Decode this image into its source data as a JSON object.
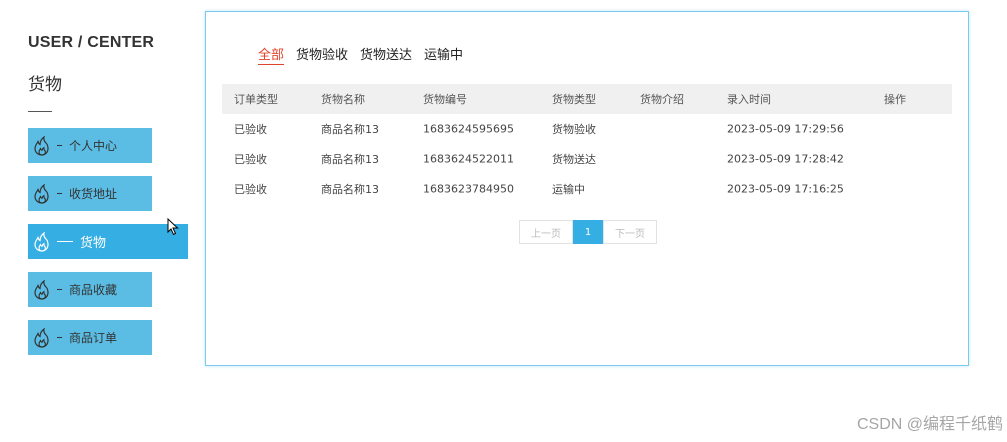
{
  "sidebar": {
    "title": "USER / CENTER",
    "subtitle": "货物",
    "items": [
      {
        "label": "个人中心",
        "icon": "flame-icon",
        "active": false
      },
      {
        "label": "收货地址",
        "icon": "flame-icon",
        "active": false
      },
      {
        "label": "货物",
        "icon": "flame-icon",
        "active": true
      },
      {
        "label": "商品收藏",
        "icon": "flame-icon",
        "active": false
      },
      {
        "label": "商品订单",
        "icon": "flame-icon",
        "active": false
      }
    ]
  },
  "tabs": [
    {
      "label": "全部",
      "active": true
    },
    {
      "label": "货物验收",
      "active": false
    },
    {
      "label": "货物送达",
      "active": false
    },
    {
      "label": "运输中",
      "active": false
    }
  ],
  "table": {
    "headers": [
      "订单类型",
      "货物名称",
      "货物编号",
      "货物类型",
      "货物介绍",
      "录入时间",
      "操作"
    ],
    "rows": [
      [
        "已验收",
        "商品名称13",
        "1683624595695",
        "货物验收",
        "",
        "2023-05-09 17:29:56",
        ""
      ],
      [
        "已验收",
        "商品名称13",
        "1683624522011",
        "货物送达",
        "",
        "2023-05-09 17:28:42",
        ""
      ],
      [
        "已验收",
        "商品名称13",
        "1683623784950",
        "运输中",
        "",
        "2023-05-09 17:16:25",
        ""
      ]
    ]
  },
  "pagination": {
    "prev_label": "上一页",
    "current_page": "1",
    "next_label": "下一页"
  },
  "watermark": "CSDN @编程千纸鹤",
  "colors": {
    "menu_bg": "#5cbde4",
    "menu_active_bg": "#35aee3",
    "tab_active": "#e0442c",
    "panel_border": "#7dcaee",
    "header_bg": "#f0f0f0"
  }
}
